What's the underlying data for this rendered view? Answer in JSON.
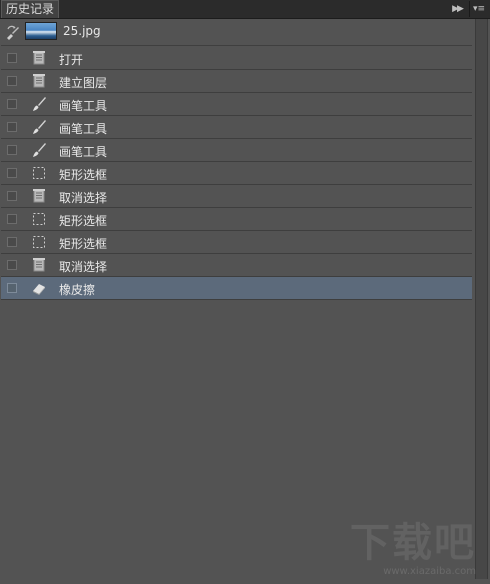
{
  "panel": {
    "tab_label": "历史记录",
    "collapse_icon": "double-chevron-right-icon",
    "menu_icon": "panel-menu-icon"
  },
  "snapshot": {
    "name": "25.jpg",
    "brush_icon": "history-brush-icon",
    "thumbnail": "snapshot-thumbnail"
  },
  "history": [
    {
      "label": "打开",
      "icon": "document-icon",
      "selected": false
    },
    {
      "label": "建立图层",
      "icon": "document-icon",
      "selected": false
    },
    {
      "label": "画笔工具",
      "icon": "brush-icon",
      "selected": false
    },
    {
      "label": "画笔工具",
      "icon": "brush-icon",
      "selected": false
    },
    {
      "label": "画笔工具",
      "icon": "brush-icon",
      "selected": false
    },
    {
      "label": "矩形选框",
      "icon": "marquee-icon",
      "selected": false
    },
    {
      "label": "取消选择",
      "icon": "document-icon",
      "selected": false
    },
    {
      "label": "矩形选框",
      "icon": "marquee-icon",
      "selected": false
    },
    {
      "label": "矩形选框",
      "icon": "marquee-icon",
      "selected": false
    },
    {
      "label": "取消选择",
      "icon": "document-icon",
      "selected": false
    },
    {
      "label": "橡皮擦",
      "icon": "eraser-icon",
      "selected": true
    }
  ],
  "watermark": {
    "text": "下载吧",
    "url": "www.xiazaiba.com"
  },
  "colors": {
    "panel_bg": "#535353",
    "selected_row": "#5c6a7b",
    "titlebar": "#2b2b2b"
  }
}
